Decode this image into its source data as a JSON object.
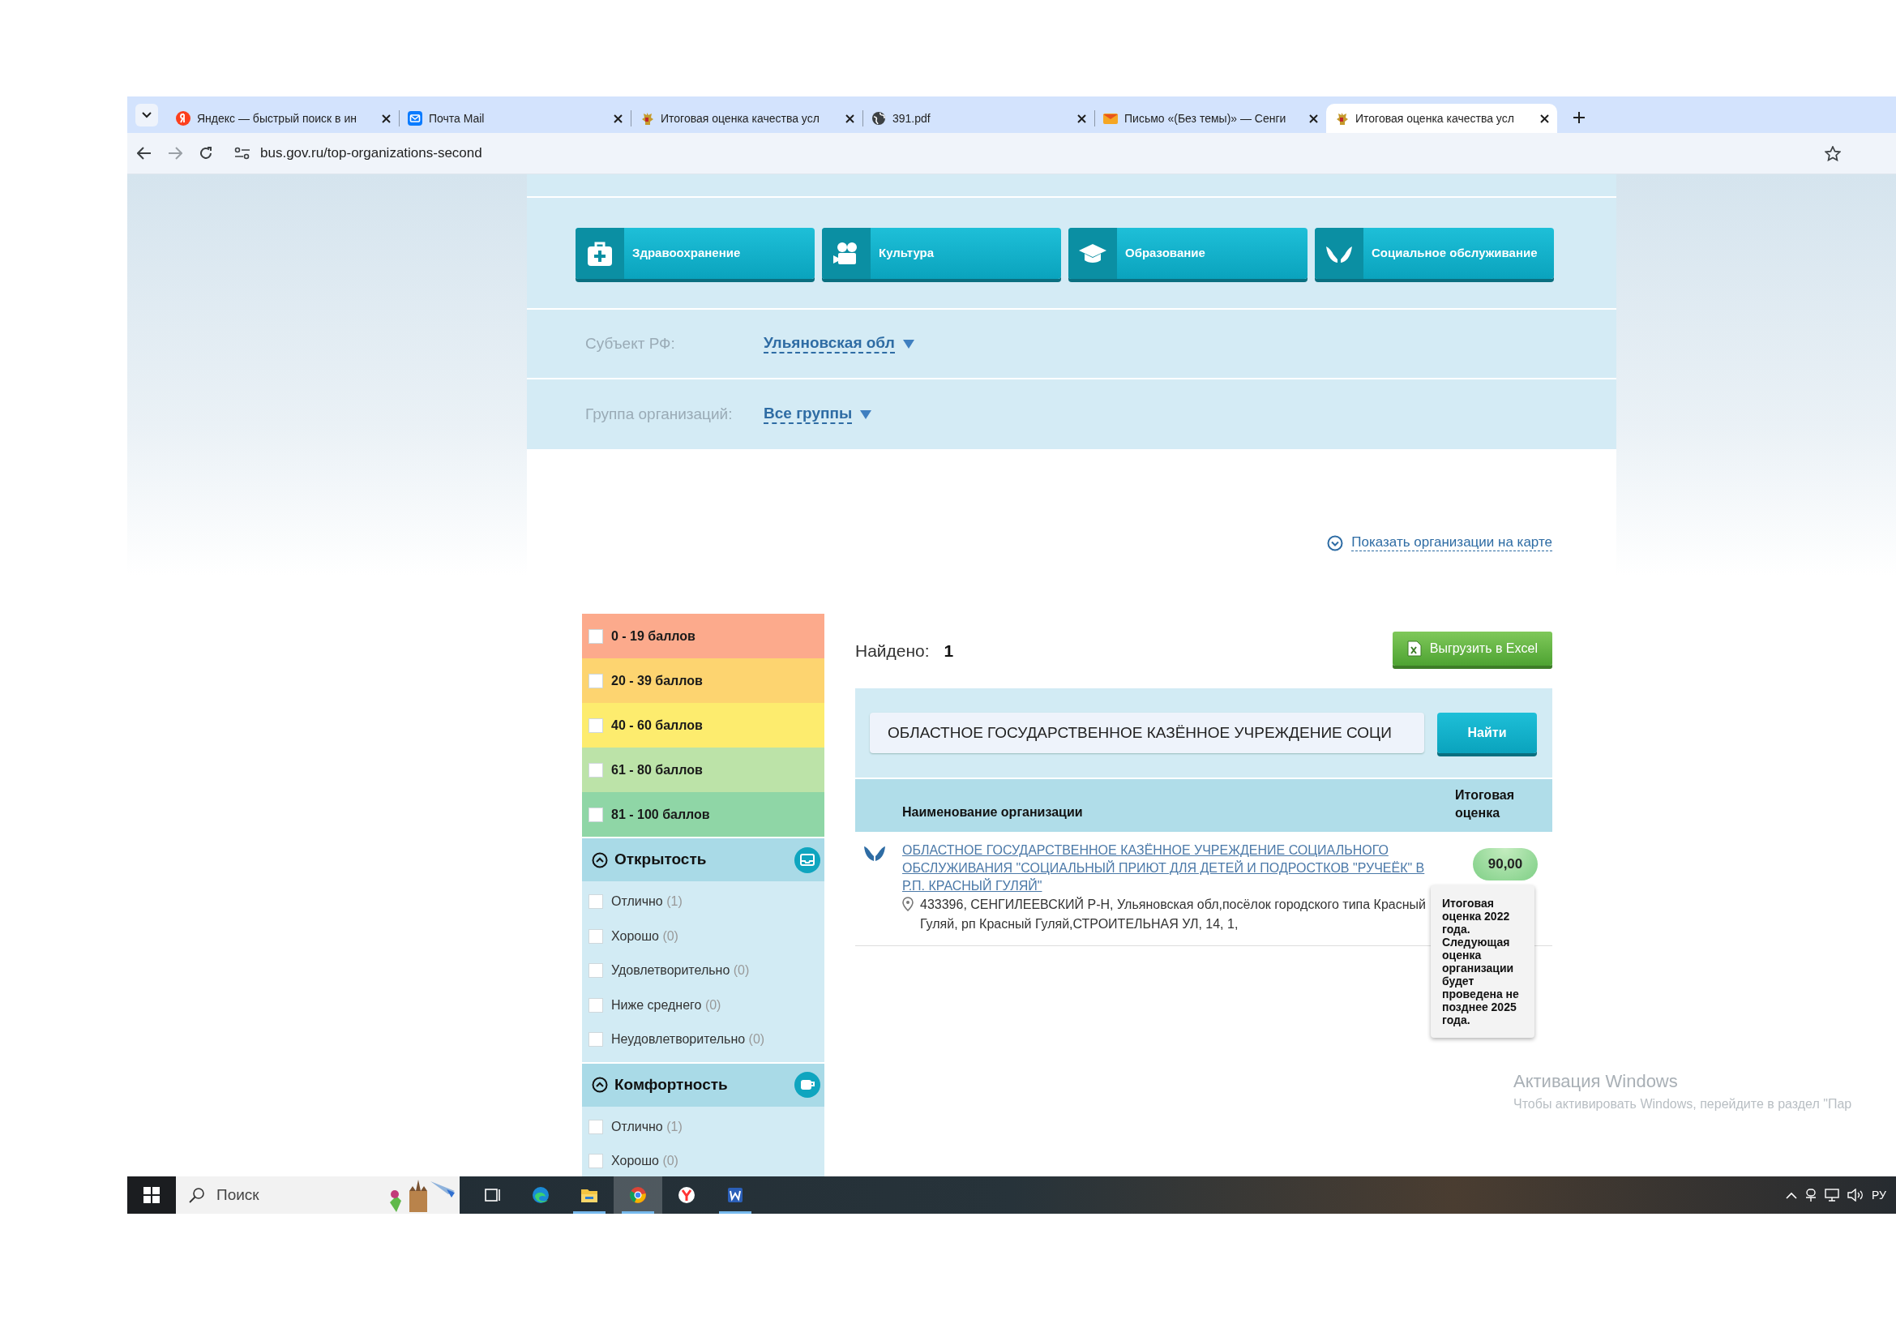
{
  "browser": {
    "tabs": [
      {
        "title": "Яндекс — быстрый поиск в ин",
        "kind": "yandex",
        "selected": false
      },
      {
        "title": "Почта Mail",
        "kind": "mail",
        "selected": false
      },
      {
        "title": "Итоговая оценка качества усл",
        "kind": "emblem",
        "selected": false
      },
      {
        "title": "391.pdf",
        "kind": "globe",
        "selected": false
      },
      {
        "title": "Письмо «(Без темы)» — Сенги",
        "kind": "envelope",
        "selected": false
      },
      {
        "title": "Итоговая оценка качества усл",
        "kind": "emblem",
        "selected": true
      }
    ],
    "url": "bus.gov.ru/top-organizations-second"
  },
  "categories": [
    {
      "label": "Здравоохранение",
      "kind": "medkit"
    },
    {
      "label": "Культура",
      "kind": "camera"
    },
    {
      "label": "Образование",
      "kind": "cap"
    },
    {
      "label": "Социальное обслуживание",
      "kind": "hands"
    }
  ],
  "filters_top": [
    {
      "label": "Субъект РФ:",
      "value": "Ульяновская обл"
    },
    {
      "label": "Группа организаций:",
      "value": "Все группы"
    }
  ],
  "map_link": "Показать организации на карте",
  "score_ranges": [
    {
      "label": "0 - 19 баллов",
      "color": "#fcaa8c",
      "checked": false
    },
    {
      "label": "20 - 39 баллов",
      "color": "#fdd470",
      "checked": false
    },
    {
      "label": "40 - 60 баллов",
      "color": "#fdec6e",
      "checked": false
    },
    {
      "label": "61 - 80 баллов",
      "color": "#bce3a8",
      "checked": false
    },
    {
      "label": "81 - 100 баллов",
      "color": "#8fd6a6",
      "checked": false
    }
  ],
  "sections": [
    {
      "title": "Открытость",
      "kind": "tray",
      "expanded": true,
      "items": [
        {
          "label": "Отлично",
          "count": "(1)",
          "checked": false
        },
        {
          "label": "Хорошо",
          "count": "(0)",
          "checked": false
        },
        {
          "label": "Удовлетворительно",
          "count": "(0)",
          "checked": false
        },
        {
          "label": "Ниже среднего",
          "count": "(0)",
          "checked": false
        },
        {
          "label": "Неудовлетворительно",
          "count": "(0)",
          "checked": false
        }
      ]
    },
    {
      "title": "Комфортность",
      "kind": "cup",
      "expanded": true,
      "items": [
        {
          "label": "Отлично",
          "count": "(1)",
          "checked": false
        },
        {
          "label": "Хорошо",
          "count": "(0)",
          "checked": false
        }
      ]
    }
  ],
  "found": {
    "label": "Найдено:",
    "count": "1"
  },
  "export_button": "Выгрузить в Excel",
  "search": {
    "value": "ОБЛАСТНОЕ ГОСУДАРСТВЕННОЕ КАЗЁННОЕ УЧРЕЖДЕНИЕ СОЦИ",
    "button": "Найти"
  },
  "table": {
    "columns": [
      "Наименование организации",
      "Итоговая оценка"
    ],
    "rows": [
      {
        "name": "ОБЛАСТНОЕ ГОСУДАРСТВЕННОЕ КАЗЁННОЕ УЧРЕЖДЕНИЕ СОЦИАЛЬНОГО ОБСЛУЖИВАНИЯ \"СОЦИАЛЬНЫЙ ПРИЮТ ДЛЯ ДЕТЕЙ И ПОДРОСТКОВ \"РУЧЕЁК\" В Р.П. КРАСНЫЙ ГУЛЯЙ\"",
        "address": "433396, СЕНГИЛЕЕВСКИЙ Р-Н, Ульяновская обл,посёлок городского типа Красный Гуляй, рп Красный Гуляй,СТРОИТЕЛЬНАЯ УЛ, 14, 1,",
        "score": "90,00",
        "tooltip": "Итоговая оценка 2022 года. Следующая оценка организации будет проведена не позднее 2025 года."
      }
    ]
  },
  "activation": {
    "title": "Активация Windows",
    "text": "Чтобы активировать Windows, перейдите в раздел \"Пар"
  },
  "taskbar": {
    "search_placeholder": "Поиск",
    "apps": [
      {
        "kind": "taskview",
        "selected": false,
        "running": false
      },
      {
        "kind": "edge",
        "selected": false,
        "running": false
      },
      {
        "kind": "explorer",
        "selected": false,
        "running": true
      },
      {
        "kind": "chrome",
        "selected": true,
        "running": true
      },
      {
        "kind": "yandex",
        "selected": false,
        "running": false
      },
      {
        "kind": "word",
        "selected": false,
        "running": true
      }
    ],
    "language": "РУ"
  }
}
